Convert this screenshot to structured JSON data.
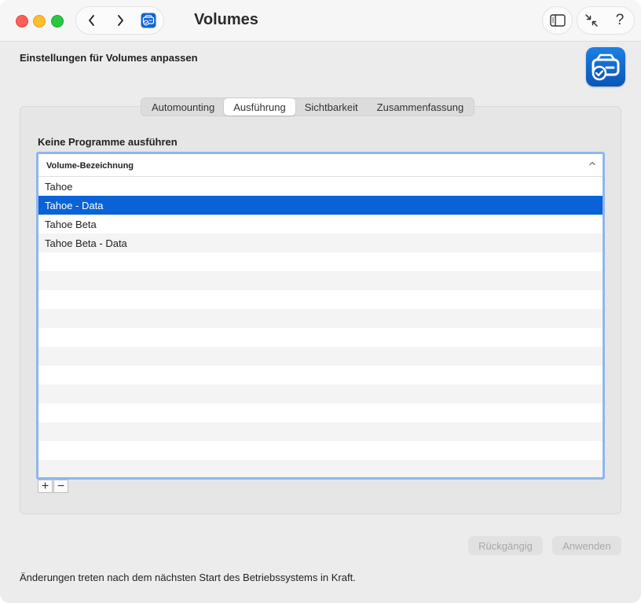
{
  "window": {
    "title": "Volumes"
  },
  "header": {
    "title": "Einstellungen für Volumes anpassen",
    "app_icon": "volume-check-app-icon"
  },
  "tabs": [
    {
      "label": "Automounting",
      "selected": false
    },
    {
      "label": "Ausführung",
      "selected": true
    },
    {
      "label": "Sichtbarkeit",
      "selected": false
    },
    {
      "label": "Zusammenfassung",
      "selected": false
    }
  ],
  "section": {
    "title": "Keine Programme ausführen"
  },
  "table": {
    "column_header": "Volume-Bezeichnung",
    "sort_indicator": "chevron-up-icon",
    "rows": [
      "Tahoe",
      "Tahoe - Data",
      "Tahoe Beta",
      "Tahoe Beta - Data"
    ],
    "selected_index": 1
  },
  "controls": {
    "add_label": "+",
    "remove_label": "−"
  },
  "buttons": {
    "undo_label": "Rückgängig",
    "apply_label": "Anwenden"
  },
  "toolbar": {
    "help_label": "?"
  },
  "footer": {
    "text": "Änderungen treten nach dem nächsten Start des Betriebssystems in Kraft."
  },
  "colors": {
    "selection": "#0a63d6",
    "focus_ring": "#8fb6ec",
    "app_icon": "#1c7fe2"
  }
}
